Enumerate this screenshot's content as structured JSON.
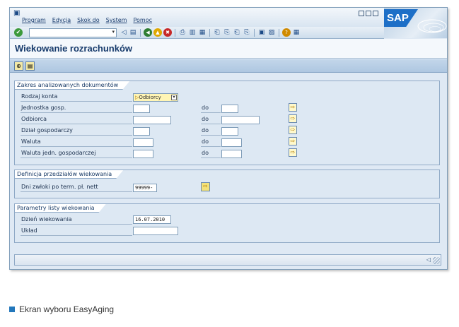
{
  "menu": {
    "items": [
      "Program",
      "Edycja",
      "Skok do",
      "System",
      "Pomoc"
    ]
  },
  "brand": {
    "logo_text": "SAP",
    "accent": "#1d6fc7"
  },
  "toolbar": {
    "icons": [
      "enter-icon",
      "command-field",
      "back-icon",
      "save-icon",
      "back-nav-icon",
      "exit-icon",
      "cancel-icon",
      "print-icon",
      "find-icon",
      "find-next-icon",
      "first-page-icon",
      "prev-page-icon",
      "next-page-icon",
      "last-page-icon",
      "new-session-icon",
      "shortcut-icon",
      "help-icon",
      "layout-icon"
    ]
  },
  "title": "Wiekowanie rozrachunków",
  "group_scope": {
    "title": "Zakres analizowanych dokumentów",
    "account_type": {
      "label": "Rodzaj konta",
      "value": "Odbiorcy"
    },
    "to_label": "do",
    "rows": [
      {
        "label": "Jednostka gosp."
      },
      {
        "label": "Odbiorca"
      },
      {
        "label": "Dział gospodarczy"
      },
      {
        "label": "Waluta"
      },
      {
        "label": "Waluta jedn. gospodarczej"
      }
    ]
  },
  "group_intervals": {
    "title": "Definicja przedziałów wiekowania",
    "days_overdue": {
      "label": "Dni zwłoki po term. pł. nett",
      "value": "99999-"
    }
  },
  "group_params": {
    "title": "Parametry listy wiekowania",
    "aging_date": {
      "label": "Dzień wiekowania",
      "value": "16.07.2010"
    },
    "layout": {
      "label": "Układ",
      "value": ""
    }
  },
  "caption": "Ekran wyboru EasyAging"
}
